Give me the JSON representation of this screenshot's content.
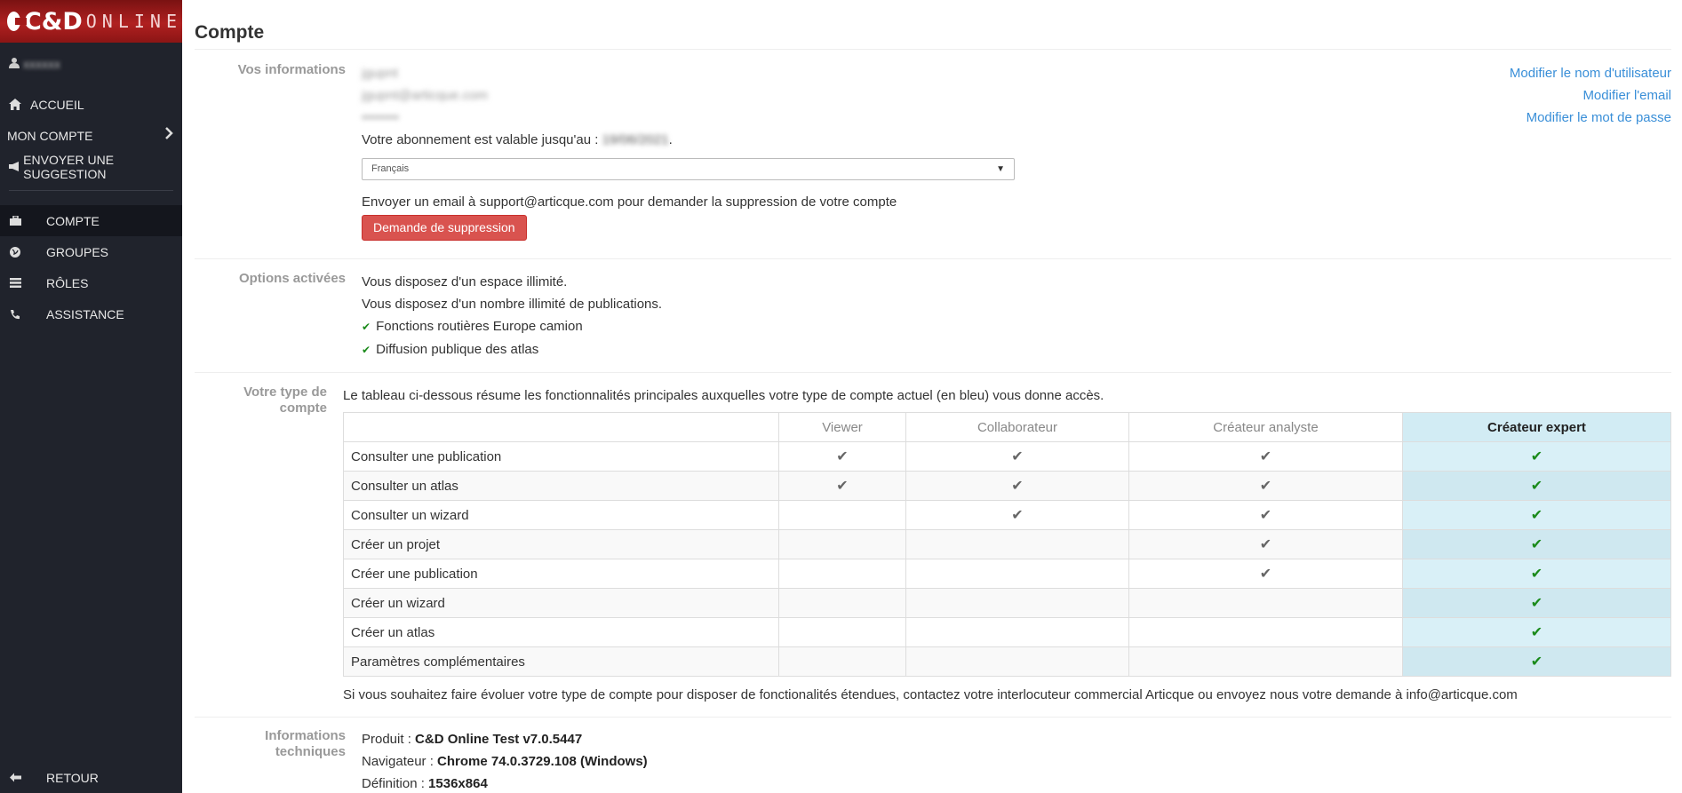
{
  "logo": {
    "main": "C&D",
    "sub": "ONLINE"
  },
  "sidebar": {
    "user_name": "xxxxxx",
    "top_items": [
      {
        "label": "ACCUEIL",
        "icon": "home-icon"
      },
      {
        "label": "MON COMPTE",
        "icon": "chevron-right-icon"
      },
      {
        "label": "ENVOYER UNE SUGGESTION",
        "icon": "megaphone-icon"
      }
    ],
    "sub_items": [
      {
        "label": "COMPTE",
        "icon": "briefcase-icon"
      },
      {
        "label": "GROUPES",
        "icon": "globe-icon"
      },
      {
        "label": "RÔLES",
        "icon": "list-icon"
      },
      {
        "label": "ASSISTANCE",
        "icon": "phone-icon"
      }
    ],
    "back_label": "RETOUR"
  },
  "page": {
    "title": "Compte"
  },
  "info": {
    "label": "Vos informations",
    "username": "jgupnt",
    "email": "jgupnt@articque.com",
    "password": "••••••••",
    "subscription_prefix": "Votre abonnement est valable jusqu'au :",
    "subscription_date": "19/06/2021",
    "language": "Français",
    "delete_text": "Envoyer un email à support@articque.com pour demander la suppression de votre compte",
    "delete_button": "Demande de suppression",
    "links": [
      "Modifier le nom d'utilisateur",
      "Modifier l'email",
      "Modifier le mot de passe"
    ]
  },
  "options": {
    "label": "Options activées",
    "lines": [
      "Vous disposez d'un espace illimité.",
      "Vous disposez d'un nombre illimité de publications."
    ],
    "checked": [
      "Fonctions routières Europe camion",
      "Diffusion publique des atlas"
    ]
  },
  "account_type": {
    "label": "Votre type de compte",
    "intro": "Le tableau ci-dessous résume les fonctionnalités principales auxquelles votre type de compte actuel (en bleu) vous donne accès.",
    "columns": [
      "Viewer",
      "Collaborateur",
      "Créateur analyste",
      "Créateur expert"
    ],
    "rows": [
      {
        "name": "Consulter une publication",
        "checks": [
          true,
          true,
          true,
          true
        ]
      },
      {
        "name": "Consulter un atlas",
        "checks": [
          true,
          true,
          true,
          true
        ]
      },
      {
        "name": "Consulter un wizard",
        "checks": [
          false,
          true,
          true,
          true
        ]
      },
      {
        "name": "Créer un projet",
        "checks": [
          false,
          false,
          true,
          true
        ]
      },
      {
        "name": "Créer une publication",
        "checks": [
          false,
          false,
          true,
          true
        ]
      },
      {
        "name": "Créer un wizard",
        "checks": [
          false,
          false,
          false,
          true
        ]
      },
      {
        "name": "Créer un atlas",
        "checks": [
          false,
          false,
          false,
          true
        ]
      },
      {
        "name": "Paramètres complémentaires",
        "checks": [
          false,
          false,
          false,
          true
        ]
      }
    ],
    "footer": "Si vous souhaitez faire évoluer votre type de compte pour disposer de fonctionalités étendues, contactez votre interlocuteur commercial Articque ou envoyez nous votre demande à info@articque.com"
  },
  "tech": {
    "label": "Informations techniques",
    "produit_label": "Produit :",
    "produit": "C&D Online Test v7.0.5447",
    "nav_label": "Navigateur :",
    "nav": "Chrome 74.0.3729.108 (Windows)",
    "def_label": "Définition :",
    "def": "1536x864"
  },
  "colors": {
    "accent": "#3a8fd8",
    "danger": "#d9534f",
    "sidebar": "#20232c",
    "highlight": "#d9f0f7",
    "check": "#1a8a1a"
  }
}
